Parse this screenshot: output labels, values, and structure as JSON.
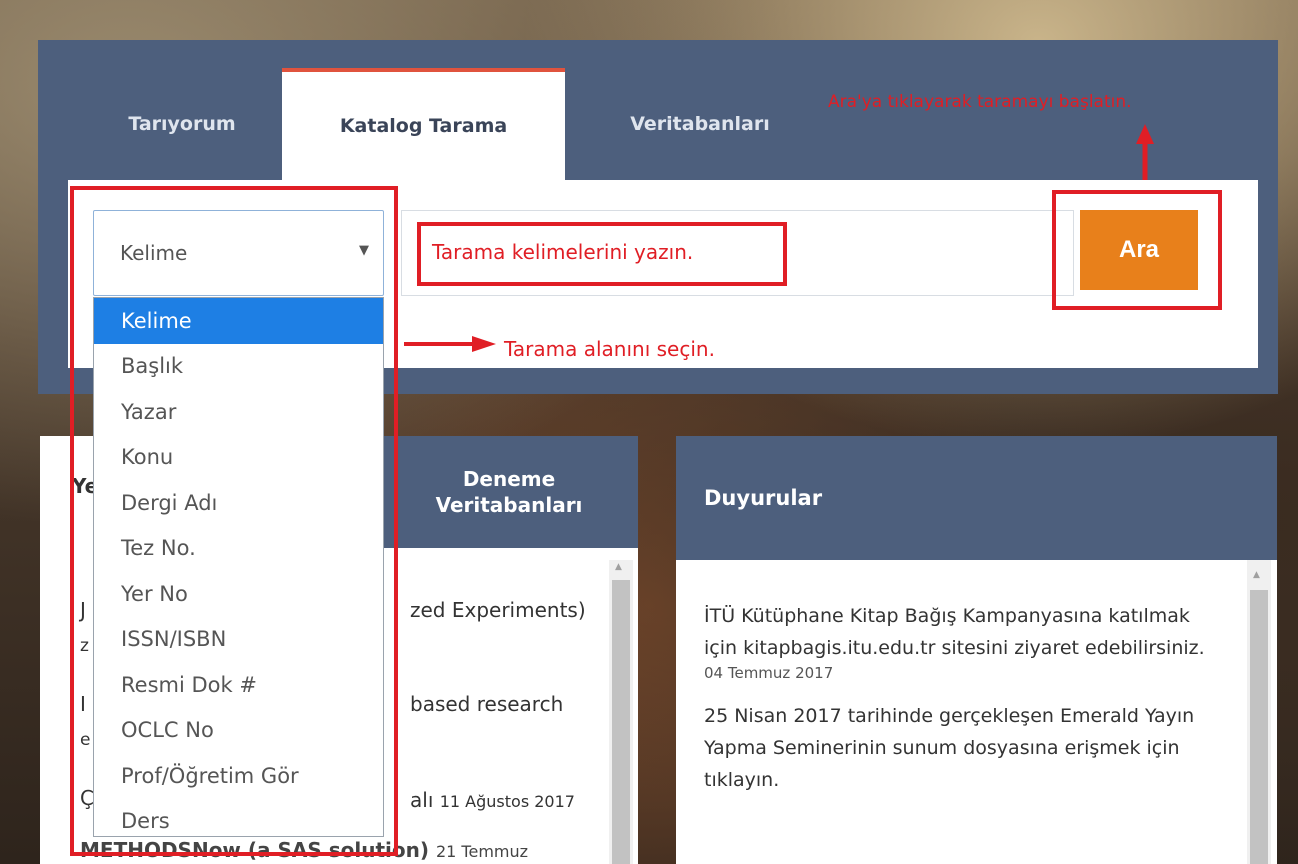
{
  "tabs": [
    {
      "label": "Tarıyorum",
      "active": false
    },
    {
      "label": "Katalog Tarama",
      "active": true
    },
    {
      "label": "Veritabanları",
      "active": false
    }
  ],
  "search": {
    "field_selected": "Kelime",
    "field_options": [
      "Kelime",
      "Başlık",
      "Yazar",
      "Konu",
      "Dergi Adı",
      "Tez No.",
      "Yer No",
      "ISSN/ISBN",
      "Resmi Dok #",
      "OCLC No",
      "Prof/Öğretim Gör",
      "Ders"
    ],
    "query_placeholder": "Tarama kelimelerini yazın.",
    "button_label": "Ara"
  },
  "annotations": {
    "start_search": "Ara'ya tıklayarak taramayı başlatın.",
    "select_field": "Tarama alanını seçin."
  },
  "left_panel": {
    "tab_partial": "Ye",
    "header": "Deneme Veritabanları",
    "items_visible": [
      {
        "lead": "J",
        "text": "zed Experiments)"
      },
      {
        "lead": "z",
        "text": ""
      },
      {
        "lead": "I",
        "text": "based research"
      },
      {
        "lead": "e",
        "text": ""
      },
      {
        "lead": "Ç",
        "text": "alı",
        "date": "11 Ağustos 2017"
      },
      {
        "text": "METHODSNow (a SAS solution)",
        "date": "21 Temmuz"
      }
    ]
  },
  "right_panel": {
    "header": "Duyurular",
    "news": [
      {
        "text": "İTÜ Kütüphane Kitap Bağış Kampanyasına katılmak için kitapbagis.itu.edu.tr sitesini ziyaret edebilirsiniz.",
        "date": "04 Temmuz 2017"
      },
      {
        "text": "25 Nisan 2017 tarihinde gerçekleşen Emerald Yayın Yapma Seminerinin sunum dosyasına erişmek için tıklayın.",
        "date": ""
      }
    ]
  },
  "colors": {
    "header_bg": "#4d5f7d",
    "accent_orange": "#e8801b",
    "annotation_red": "#e01e25",
    "selected_blue": "#1e7fe4",
    "active_tab_border": "#e0533e"
  }
}
